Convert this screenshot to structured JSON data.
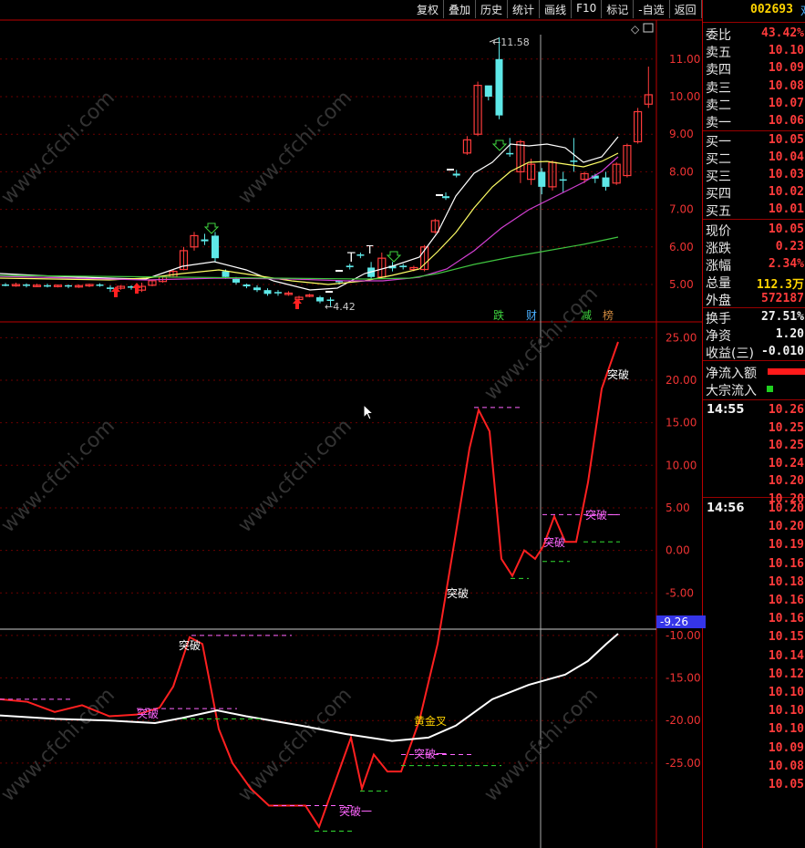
{
  "toolbar": [
    "复权",
    "叠加",
    "历史",
    "统计",
    "画线",
    "F10",
    "标记",
    "-自选",
    "返回"
  ],
  "stock": {
    "code": "002693",
    "code_suffix": "双"
  },
  "quote": [
    {
      "label": "委比",
      "value": "43.42%",
      "color": "red"
    },
    {
      "label": "卖五",
      "value": "10.10",
      "color": "red"
    },
    {
      "label": "卖四",
      "value": "10.09",
      "color": "red"
    },
    {
      "label": "卖三",
      "value": "10.08",
      "color": "red"
    },
    {
      "label": "卖二",
      "value": "10.07",
      "color": "red"
    },
    {
      "label": "卖一",
      "value": "10.06",
      "color": "red"
    },
    {
      "label": "买一",
      "value": "10.05",
      "color": "red"
    },
    {
      "label": "买二",
      "value": "10.04",
      "color": "red"
    },
    {
      "label": "买三",
      "value": "10.03",
      "color": "red"
    },
    {
      "label": "买四",
      "value": "10.02",
      "color": "red"
    },
    {
      "label": "买五",
      "value": "10.01",
      "color": "red"
    },
    {
      "label": "现价",
      "value": "10.05",
      "color": "red"
    },
    {
      "label": "涨跌",
      "value": "0.23",
      "color": "red"
    },
    {
      "label": "涨幅",
      "value": "2.34%",
      "color": "red"
    },
    {
      "label": "总量",
      "value": "112.3万",
      "color": "yellow"
    },
    {
      "label": "外盘",
      "value": "572187",
      "color": "red"
    },
    {
      "label": "换手",
      "value": "27.51%",
      "color": "white"
    },
    {
      "label": "净资",
      "value": "1.20",
      "color": "white"
    },
    {
      "label": "收益(三)",
      "value": "-0.010",
      "color": "white"
    },
    {
      "label": "净流入额",
      "value": "",
      "color": "red"
    },
    {
      "label": "大宗流入",
      "value": "",
      "color": "green"
    }
  ],
  "ticks": {
    "t1": "14:55",
    "t1_prices": [
      "10.26",
      "10.25",
      "10.25",
      "10.24",
      "10.20",
      "10.20"
    ],
    "t2": "14:56",
    "t2_prices": [
      "10.20",
      "10.20",
      "10.19",
      "10.16",
      "10.18",
      "10.16",
      "10.16",
      "10.15",
      "10.14",
      "10.12",
      "10.10",
      "10.10",
      "10.10",
      "10.09",
      "10.08",
      "10.05"
    ]
  },
  "price_axis": [
    "11.00",
    "10.00",
    "9.00",
    "8.00",
    "7.00",
    "6.00",
    "5.00"
  ],
  "flow_axis": [
    "25.00",
    "20.00",
    "15.00",
    "10.00",
    "5.00",
    "0.00",
    "-5.00",
    "-10.00",
    "-15.00",
    "-20.00",
    "-25.00"
  ],
  "cursor_value": "-9.26",
  "annotations": {
    "high": "11.58",
    "low": "4.42",
    "tags": [
      "跌",
      "财",
      "减",
      "榜"
    ],
    "breakthrough": "突破",
    "breakthrough_one": "突破一",
    "golden_cross": "黄金叉"
  },
  "watermark": "www.cfchi.com",
  "colors": {
    "up": "#ff3b3b",
    "down": "#5ee8e8",
    "ma5": "#ffffff",
    "ma10": "#ffff66",
    "ma20": "#d23fd2",
    "ma60": "#3fc43f",
    "flow": "#ff2020",
    "flow_ma": "#ffffff",
    "breakout": "#ff66ff",
    "support": "#33dd33"
  }
}
